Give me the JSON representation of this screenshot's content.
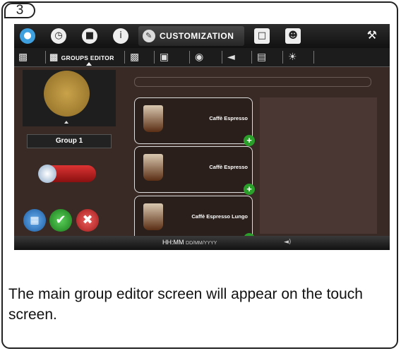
{
  "step": {
    "number": "3"
  },
  "topbar": {
    "icons": [
      "water-drop-icon",
      "clock-icon",
      "cup-icon",
      "info-icon"
    ],
    "active_tab_label": "CUSTOMIZATION",
    "right_icons": [
      "screen-icon",
      "user-icon"
    ],
    "wrench": "wrench-icon"
  },
  "subbar": {
    "active_tab_label": "GROUPS EDITOR"
  },
  "left": {
    "group_label": "Group 1"
  },
  "drinks": [
    {
      "name": "Caffè Espresso"
    },
    {
      "name": "Caffè Espresso"
    },
    {
      "name": "Caffè Espresso Lungo"
    }
  ],
  "statusbar": {
    "time": "HH:MM",
    "date": "DD/MM/YYYY"
  },
  "caption": "The main group editor screen will appear on the touch screen."
}
